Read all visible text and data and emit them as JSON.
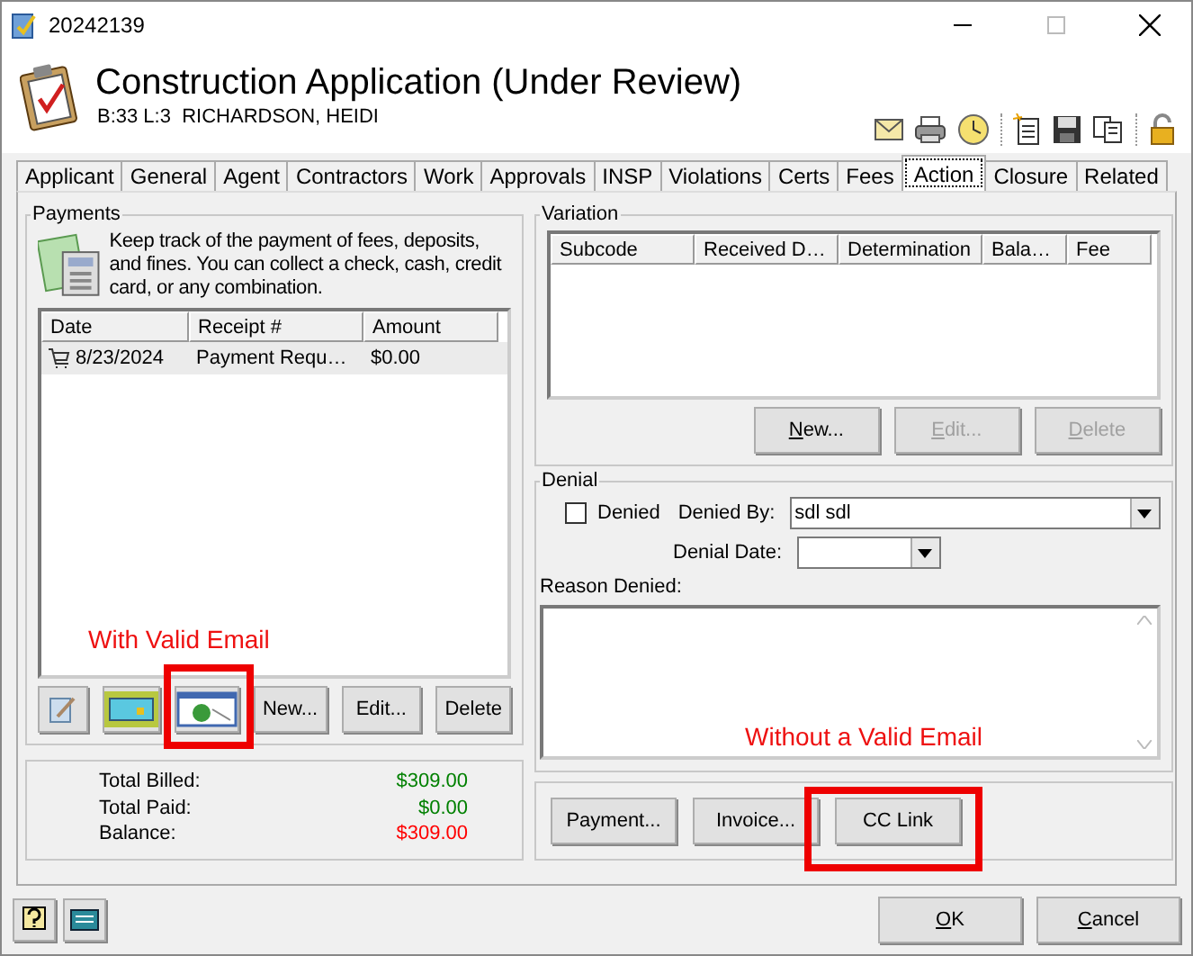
{
  "window": {
    "title": "20242139"
  },
  "header": {
    "title": "Construction Application (Under Review)",
    "subtitle": "B:33 L:3  RICHARDSON, HEIDI"
  },
  "tabs": [
    {
      "label": "Applicant",
      "selected": false
    },
    {
      "label": "General",
      "selected": false
    },
    {
      "label": "Agent",
      "selected": false
    },
    {
      "label": "Contractors",
      "selected": false
    },
    {
      "label": "Work",
      "selected": false
    },
    {
      "label": "Approvals",
      "selected": false
    },
    {
      "label": "INSP",
      "selected": false
    },
    {
      "label": "Violations",
      "selected": false
    },
    {
      "label": "Certs",
      "selected": false
    },
    {
      "label": "Fees",
      "selected": false
    },
    {
      "label": "Action",
      "selected": true
    },
    {
      "label": "Closure",
      "selected": false
    },
    {
      "label": "Related",
      "selected": false
    }
  ],
  "payments": {
    "title": "Payments",
    "description": "Keep track of the payment of fees, deposits, and fines. You can collect a check, cash, credit card, or any combination.",
    "columns": [
      "Date",
      "Receipt #",
      "Amount"
    ],
    "rows": [
      {
        "date": "8/23/2024",
        "receipt": "Payment Requ…",
        "amount": "$0.00",
        "selected": true
      }
    ],
    "buttons": [
      {
        "label": "New..."
      },
      {
        "label": "Edit..."
      },
      {
        "label": "Delete"
      }
    ]
  },
  "totals": [
    {
      "label": "Total Billed:",
      "value": "$309.00",
      "color": "#008000"
    },
    {
      "label": "Total Paid:",
      "value": "$0.00",
      "color": "#008000"
    },
    {
      "label": "Balance:",
      "value": "$309.00",
      "color": "#ff0000"
    }
  ],
  "variation": {
    "title": "Variation",
    "columns": [
      "Subcode",
      "Received D…",
      "Determination",
      "Bala…",
      "Fee"
    ],
    "buttons": [
      {
        "label": "New...",
        "disabled": false
      },
      {
        "label": "Edit...",
        "disabled": true
      },
      {
        "label": "Delete",
        "disabled": true
      }
    ]
  },
  "denial": {
    "title": "Denial",
    "denied": {
      "label": "Denied",
      "checked": false
    },
    "denied_by": {
      "label": "Denied By:",
      "value": "sdl sdl"
    },
    "denial_date": {
      "label": "Denial Date:"
    },
    "reason": {
      "label": "Reason Denied:"
    }
  },
  "actions": [
    {
      "label": "Payment..."
    },
    {
      "label": "Invoice..."
    },
    {
      "label": "CC Link"
    }
  ],
  "footer": {
    "buttons": [
      {
        "label": "OK"
      },
      {
        "label": "Cancel"
      }
    ]
  },
  "annotations": [
    {
      "text": "With Valid Email"
    },
    {
      "text": "Without a Valid Email"
    }
  ]
}
